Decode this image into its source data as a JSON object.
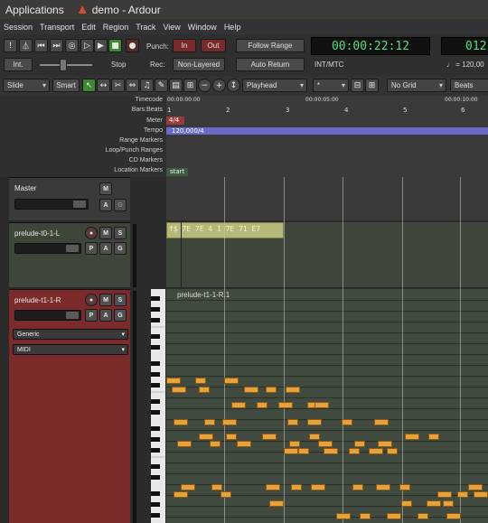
{
  "topbar": {
    "applications": "Applications",
    "window_title": "demo - Ardour"
  },
  "menus": [
    "Session",
    "Transport",
    "Edit",
    "Region",
    "Track",
    "View",
    "Window",
    "Help"
  ],
  "transport": {
    "punch_label": "Punch:",
    "in_label": "In",
    "out_label": "Out",
    "follow_range": "Follow Range",
    "rec_label": "Rec:",
    "non_layered": "Non-Layered",
    "auto_return": "Auto Return",
    "int_label": "Int.",
    "stop_label": "Stop",
    "primary_clock": "00:00:22:12",
    "int_mtc": "INT/MTC",
    "secondary_clock": "012",
    "tempo_readout": "♩ = 120,00"
  },
  "edit_toolbar": {
    "edit_mode": "Slide",
    "smart": "Smart",
    "edit_point": "Playhead",
    "nudge": "*",
    "grid": "No Grid",
    "beats": "Beats"
  },
  "rulers": {
    "labels": [
      "Timecode",
      "Bars:Beats",
      "Meter",
      "Tempo",
      "Range Markers",
      "Loop/Punch Ranges",
      "CD Markers",
      "Location Markers"
    ],
    "timecode_ticks": [
      "00:00:00:00",
      "00:00:05:00",
      "00:00:10:00"
    ],
    "bar_ticks": [
      "1",
      "2",
      "3",
      "4",
      "5",
      "6"
    ],
    "meter_value": "4/4",
    "tempo_value": "120,000/4",
    "location_marker": "start"
  },
  "tracks": [
    {
      "name": "Master"
    },
    {
      "name": "prelude-t0-1-L",
      "region_text": "f$ 7E 7E 4 1 7E 71 E7"
    },
    {
      "name": "prelude-t1-1-R",
      "region_name": "prelude-t1-1-R.1",
      "instrument": "Generic",
      "type": "MIDI"
    }
  ],
  "colors": {
    "clock_green": "#53e07a",
    "midi_track": "#7d2a2a",
    "audio_track": "#3c463a",
    "note": "#e8a23a",
    "tempo_bar": "#6a6ac8"
  }
}
